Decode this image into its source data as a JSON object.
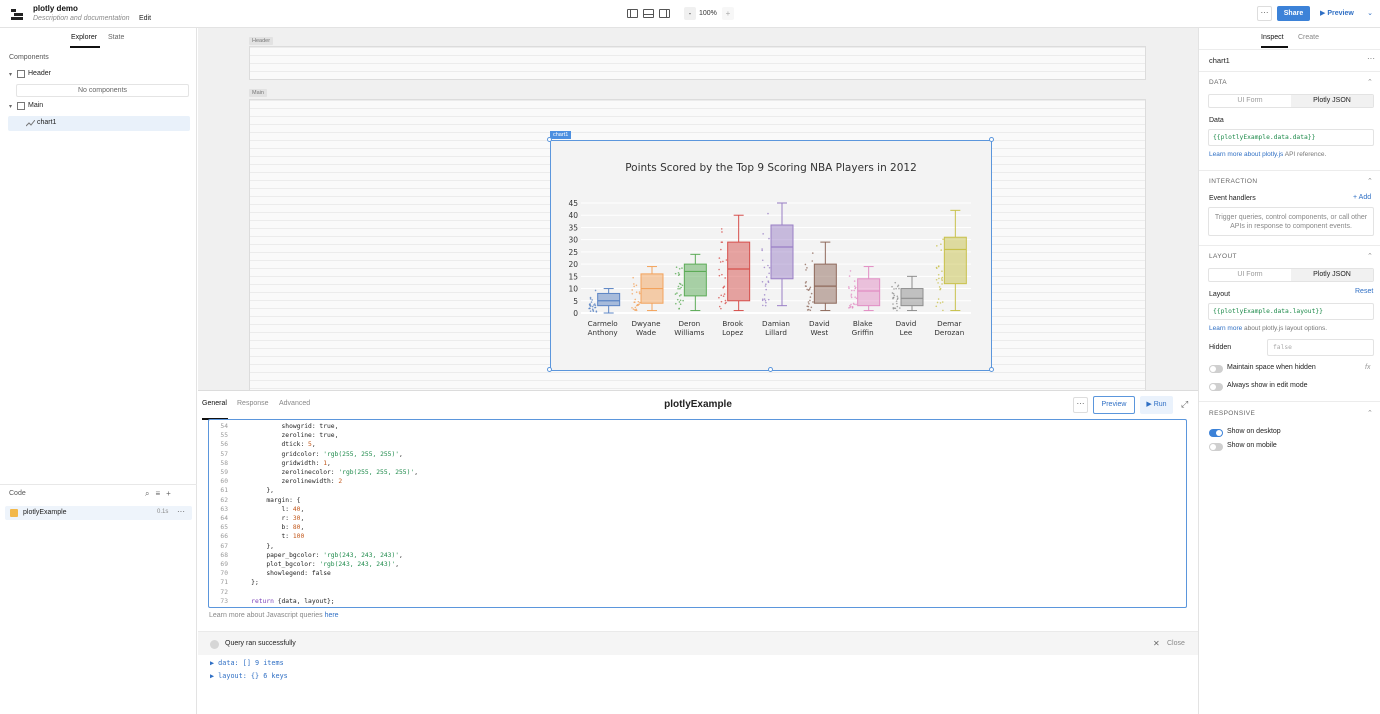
{
  "topbar": {
    "title": "plotly demo",
    "description": "Description and documentation",
    "edit": "Edit",
    "zoom": "100%",
    "zoom_minus": "-",
    "zoom_plus": "+",
    "more": "···",
    "share": "Share",
    "preview": "▶ Preview",
    "preview_chevron": "⌄"
  },
  "left": {
    "tabs": [
      "Explorer",
      "State"
    ],
    "components_label": "Components",
    "tree": {
      "header": "Header",
      "no_components": "No components",
      "main": "Main",
      "chart": "chart1"
    },
    "code_label": "Code",
    "query": {
      "name": "plotlyExample",
      "time": "0.1s",
      "more": "···"
    }
  },
  "canvas": {
    "header_label": "Header",
    "main_label": "Main",
    "chart_tag": "chart1"
  },
  "chart_data": {
    "type": "box",
    "title": "Points Scored by the Top 9 Scoring NBA Players in 2012",
    "xlabel": "",
    "ylabel": "",
    "ylim": [
      0,
      45
    ],
    "y_ticks": [
      0,
      5,
      10,
      15,
      20,
      25,
      30,
      35,
      40,
      45
    ],
    "grid": true,
    "showlegend": false,
    "series": [
      {
        "name": "Carmelo Anthony",
        "label": [
          "Carmelo",
          "Anthony"
        ],
        "color": "#5b84c4",
        "min": 0,
        "q1": 3,
        "median": 5,
        "q3": 8,
        "max": 10
      },
      {
        "name": "Dwyane Wade",
        "label": [
          "Dwyane",
          "Wade"
        ],
        "color": "#f3a35c",
        "min": 1,
        "q1": 4,
        "median": 10,
        "q3": 16,
        "max": 19
      },
      {
        "name": "Deron Williams",
        "label": [
          "Deron",
          "Williams"
        ],
        "color": "#5cab57",
        "min": 1,
        "q1": 7,
        "median": 17,
        "q3": 20,
        "max": 24
      },
      {
        "name": "Brook Lopez",
        "label": [
          "Brook",
          "Lopez"
        ],
        "color": "#d64f4b",
        "min": 1,
        "q1": 5,
        "median": 18,
        "q3": 29,
        "max": 40
      },
      {
        "name": "Damian Lillard",
        "label": [
          "Damian",
          "Lillard"
        ],
        "color": "#9a7fc6",
        "min": 3,
        "q1": 14,
        "median": 27,
        "q3": 36,
        "max": 45
      },
      {
        "name": "David West",
        "label": [
          "David",
          "West"
        ],
        "color": "#8f6a5c",
        "min": 1,
        "q1": 4,
        "median": 11,
        "q3": 20,
        "max": 29
      },
      {
        "name": "Blake Griffin",
        "label": [
          "Blake",
          "Griffin"
        ],
        "color": "#e28dc4",
        "min": 1,
        "q1": 3,
        "median": 9,
        "q3": 14,
        "max": 19
      },
      {
        "name": "David Lee",
        "label": [
          "David",
          "Lee"
        ],
        "color": "#8e8e8e",
        "min": 1,
        "q1": 3,
        "median": 6,
        "q3": 10,
        "max": 15
      },
      {
        "name": "Demar Derozan",
        "label": [
          "Demar",
          "Derozan"
        ],
        "color": "#c8c14b",
        "min": 1,
        "q1": 12,
        "median": 26,
        "q3": 31,
        "max": 42
      }
    ]
  },
  "bottom": {
    "tabs": [
      "General",
      "Response",
      "Advanced"
    ],
    "title": "plotlyExample",
    "more": "···",
    "preview": "Preview",
    "run": "▶ Run",
    "learn_text": "Learn more about Javascript queries ",
    "learn_link": "here",
    "status": "Query ran successfully",
    "close": "Close",
    "result_lines": [
      "▶ data: [] 9 items",
      "▶ layout: {} 6 keys"
    ]
  },
  "code": [
    {
      "n": "54",
      "t": "            showgrid: true,"
    },
    {
      "n": "55",
      "t": "            zeroline: true,"
    },
    {
      "n": "56",
      "t": "            dtick: 5,"
    },
    {
      "n": "57",
      "t": "            gridcolor: 'rgb(255, 255, 255)',"
    },
    {
      "n": "58",
      "t": "            gridwidth: 1,"
    },
    {
      "n": "59",
      "t": "            zerolinecolor: 'rgb(255, 255, 255)',"
    },
    {
      "n": "60",
      "t": "            zerolinewidth: 2"
    },
    {
      "n": "61",
      "t": "        },"
    },
    {
      "n": "62",
      "t": "        margin: {"
    },
    {
      "n": "63",
      "t": "            l: 40,"
    },
    {
      "n": "64",
      "t": "            r: 30,"
    },
    {
      "n": "65",
      "t": "            b: 80,"
    },
    {
      "n": "66",
      "t": "            t: 100"
    },
    {
      "n": "67",
      "t": "        },"
    },
    {
      "n": "68",
      "t": "        paper_bgcolor: 'rgb(243, 243, 243)',"
    },
    {
      "n": "69",
      "t": "        plot_bgcolor: 'rgb(243, 243, 243)',"
    },
    {
      "n": "70",
      "t": "        showlegend: false"
    },
    {
      "n": "71",
      "t": "    };"
    },
    {
      "n": "72",
      "t": ""
    },
    {
      "n": "73",
      "t": "    return {data, layout};"
    }
  ],
  "right": {
    "tabs": [
      "Inspect",
      "Create"
    ],
    "component": "chart1",
    "more": "···",
    "data_section": "DATA",
    "seg_ui": "UI Form",
    "seg_json": "Plotly JSON",
    "data_label": "Data",
    "data_value": "{{plotlyExample.data.data}}",
    "data_learn": "Learn more about plotly.js",
    "data_learn_rest": " API reference.",
    "interaction_section": "INTERACTION",
    "event_handlers": "Event handlers",
    "add": "+ Add",
    "event_hint": "Trigger queries, control components, or call other APIs in response to component events.",
    "layout_section": "LAYOUT",
    "layout_label": "Layout",
    "reset": "Reset",
    "layout_value": "{{plotlyExample.data.layout}}",
    "layout_learn": "Learn more",
    "layout_learn_rest": " about plotly.js layout options.",
    "hidden_label": "Hidden",
    "hidden_placeholder": "false",
    "maintain_space": "Maintain space when hidden",
    "fx": "fx",
    "always_show": "Always show in edit mode",
    "responsive_section": "RESPONSIVE",
    "show_desktop": "Show on desktop",
    "show_mobile": "Show on mobile"
  }
}
